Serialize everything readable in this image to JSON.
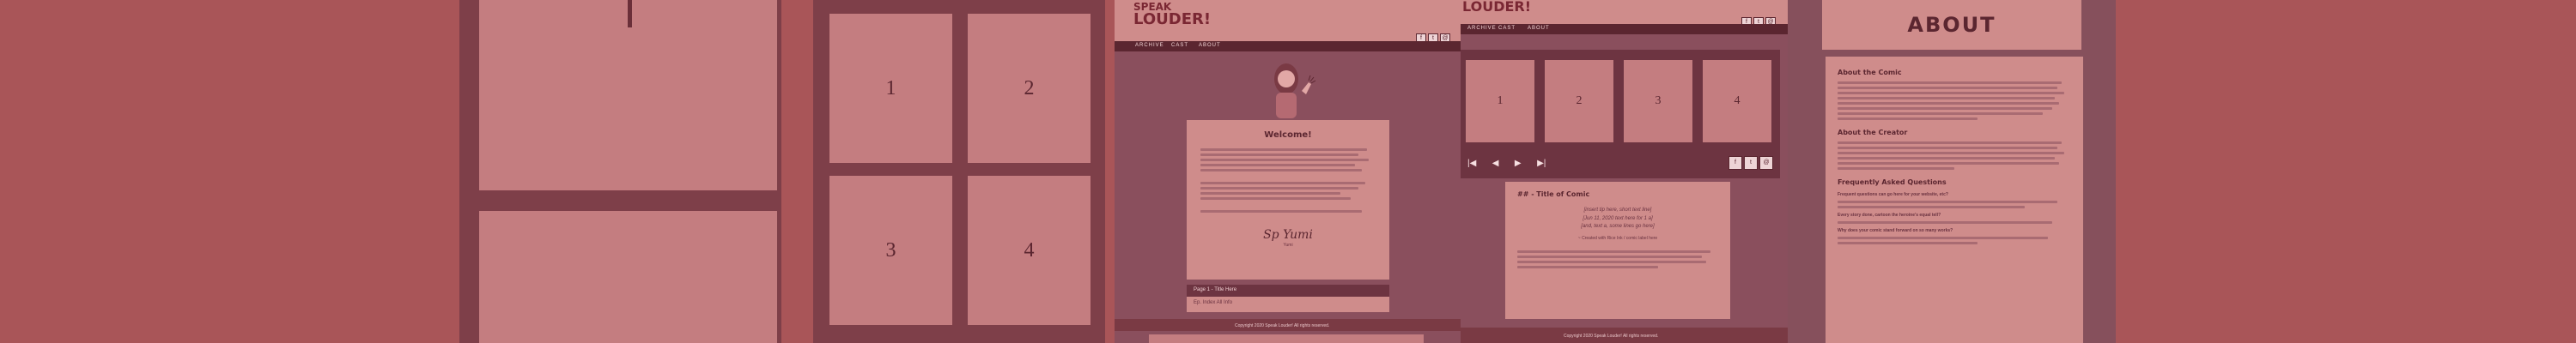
{
  "brand": {
    "line1": "SPEAK",
    "line2": "LOUDER!",
    "line2_alt": "LOUDER!"
  },
  "nav": [
    "ARCHIVE",
    "CAST",
    "ABOUT"
  ],
  "grid": [
    "1",
    "2",
    "3",
    "4"
  ],
  "strip": [
    "1",
    "2",
    "3",
    "4"
  ],
  "welcome": {
    "title": "Welcome!",
    "signature": "Sp Yumi",
    "sig_caption": "Yumi"
  },
  "latest": {
    "title": "Page 1 - Title Here",
    "sub": "Ep. Index All Info"
  },
  "comic": {
    "title": "## - Title of Comic",
    "poem1": "[insert tip here, short text line]",
    "poem2": "[Jun 11, 2020 text here for 1 a]",
    "poem3": "[and, text a, some lines go here]",
    "poem4": "~ Created with Rice Ink / comic label here"
  },
  "footer": {
    "copy": "Copyright 2020 Speak Louder! All rights reserved."
  },
  "about": {
    "title": "ABOUT",
    "h1": "About the Comic",
    "h2": "About the Creator",
    "h3": "Frequently Asked Questions",
    "q1": "Frequent questions can go here for your website, etc?",
    "q2": "Every story done, cartoon the heroine’s equal tell?",
    "q3": "Why does your comic stand forward on so many works?"
  },
  "icons": {
    "social": [
      "facebook-icon",
      "twitter-icon",
      "email-icon"
    ]
  }
}
